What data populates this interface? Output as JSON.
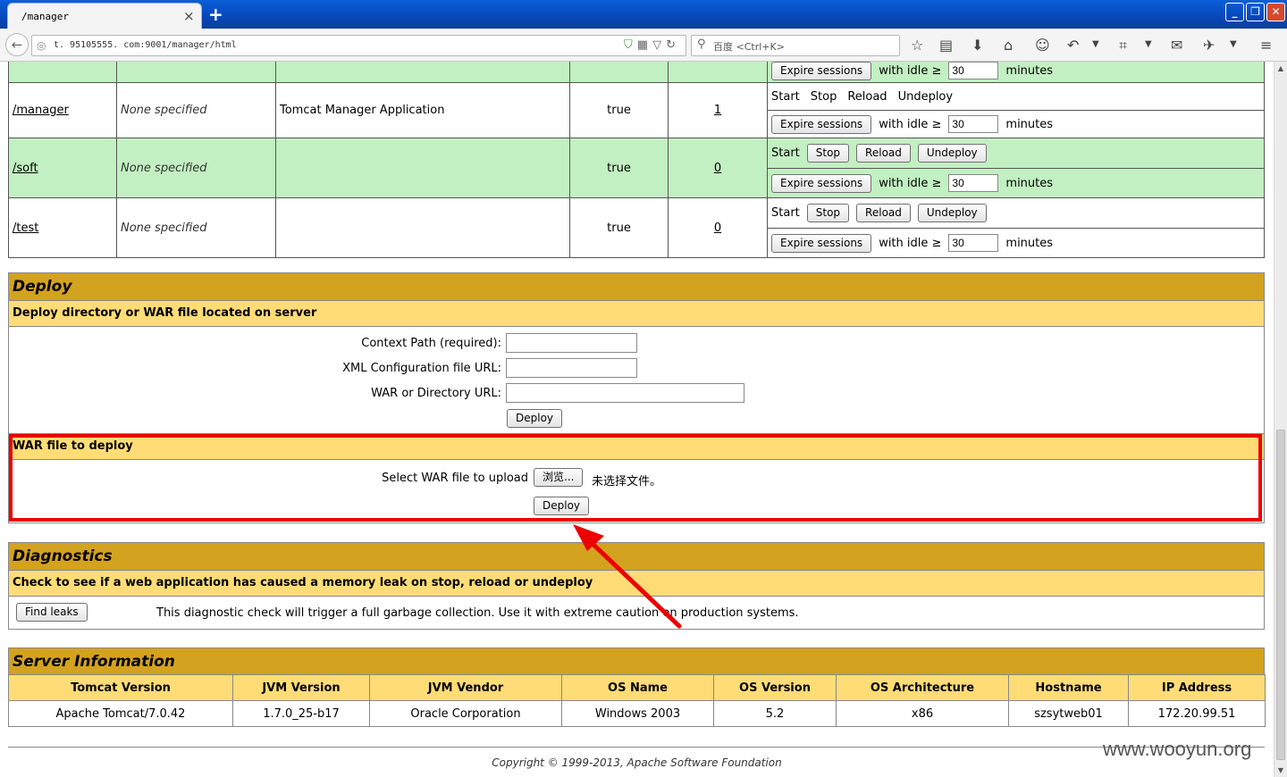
{
  "browser": {
    "tab_title": "/manager",
    "tab_close": "×",
    "new_tab": "+",
    "url": "t. 95105555. com:9001/manager/html",
    "search_placeholder": "百度 <Ctrl+K>",
    "window_buttons": [
      "_",
      "❐",
      "✕"
    ]
  },
  "apps": {
    "partial_row": {
      "expire_label": "Expire sessions",
      "with_idle": "with idle ≥",
      "idle_value": "30",
      "minutes": "minutes"
    },
    "rows": [
      {
        "path": "/manager",
        "version": "None specified",
        "display_name": "Tomcat Manager Application",
        "running": "true",
        "sessions": "1",
        "commands": [
          "Start",
          "Stop",
          "Reload",
          "Undeploy"
        ],
        "commands_as_buttons": false,
        "expire_label": "Expire sessions",
        "with_idle": "with idle ≥",
        "idle_value": "30",
        "minutes": "minutes"
      },
      {
        "path": "/soft",
        "version": "None specified",
        "display_name": "",
        "running": "true",
        "sessions": "0",
        "commands": [
          "Start",
          "Stop",
          "Reload",
          "Undeploy"
        ],
        "commands_as_buttons": true,
        "expire_label": "Expire sessions",
        "with_idle": "with idle ≥",
        "idle_value": "30",
        "minutes": "minutes"
      },
      {
        "path": "/test",
        "version": "None specified",
        "display_name": "",
        "running": "true",
        "sessions": "0",
        "commands": [
          "Start",
          "Stop",
          "Reload",
          "Undeploy"
        ],
        "commands_as_buttons": true,
        "expire_label": "Expire sessions",
        "with_idle": "with idle ≥",
        "idle_value": "30",
        "minutes": "minutes"
      }
    ]
  },
  "deploy": {
    "title": "Deploy",
    "server_subtitle": "Deploy directory or WAR file located on server",
    "context_path_label": "Context Path (required):",
    "xml_config_label": "XML Configuration file URL:",
    "war_dir_label": "WAR or Directory URL:",
    "deploy_button": "Deploy",
    "war_subtitle": "WAR file to deploy",
    "select_war_label": "Select WAR file to upload",
    "browse_button": "浏览...",
    "no_file_text": "未选择文件。",
    "war_deploy_button": "Deploy"
  },
  "diagnostics": {
    "title": "Diagnostics",
    "subtitle": "Check to see if a web application has caused a memory leak on stop, reload or undeploy",
    "find_leaks_button": "Find leaks",
    "description": "This diagnostic check will trigger a full garbage collection. Use it with extreme caution on production systems."
  },
  "server_info": {
    "title": "Server Information",
    "headers": [
      "Tomcat Version",
      "JVM Version",
      "JVM Vendor",
      "OS Name",
      "OS Version",
      "OS Architecture",
      "Hostname",
      "IP Address"
    ],
    "values": [
      "Apache Tomcat/7.0.42",
      "1.7.0_25-b17",
      "Oracle Corporation",
      "Windows 2003",
      "5.2",
      "x86",
      "szsytweb01",
      "172.20.99.51"
    ]
  },
  "footer": {
    "copyright": "Copyright © 1999-2013, Apache Software Foundation"
  },
  "watermark": "www.wooyun.org"
}
